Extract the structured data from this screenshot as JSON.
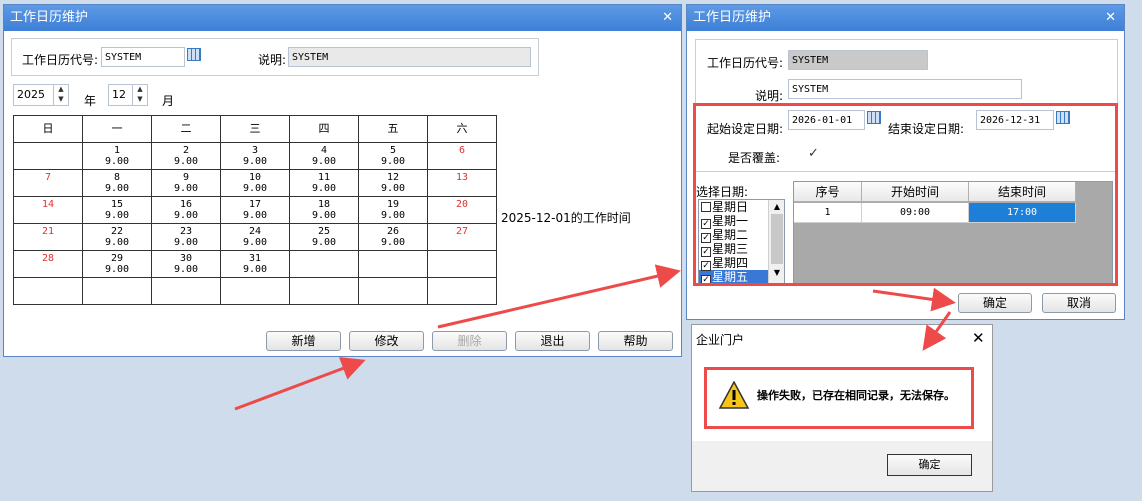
{
  "main_window": {
    "title": "工作日历维护",
    "code_label": "工作日历代号:",
    "code_value": "SYSTEM",
    "desc_label": "说明:",
    "desc_value": "SYSTEM",
    "year_value": "2025",
    "year_label": "年",
    "month_value": "12",
    "month_label": "月",
    "weekday_headers": [
      "日",
      "一",
      "二",
      "三",
      "四",
      "五",
      "六"
    ],
    "worktime_caption": "2025-12-01的工作时间",
    "buttons": {
      "add": "新增",
      "edit": "修改",
      "delete": "删除",
      "exit": "退出",
      "help": "帮助"
    }
  },
  "calendar_weeks": [
    [
      {
        "d": "",
        "h": ""
      },
      {
        "d": "1",
        "h": "9.00"
      },
      {
        "d": "2",
        "h": "9.00"
      },
      {
        "d": "3",
        "h": "9.00"
      },
      {
        "d": "4",
        "h": "9.00"
      },
      {
        "d": "5",
        "h": "9.00"
      },
      {
        "d": "6",
        "h": ""
      }
    ],
    [
      {
        "d": "7",
        "h": ""
      },
      {
        "d": "8",
        "h": "9.00"
      },
      {
        "d": "9",
        "h": "9.00"
      },
      {
        "d": "10",
        "h": "9.00"
      },
      {
        "d": "11",
        "h": "9.00"
      },
      {
        "d": "12",
        "h": "9.00"
      },
      {
        "d": "13",
        "h": ""
      }
    ],
    [
      {
        "d": "14",
        "h": ""
      },
      {
        "d": "15",
        "h": "9.00"
      },
      {
        "d": "16",
        "h": "9.00"
      },
      {
        "d": "17",
        "h": "9.00"
      },
      {
        "d": "18",
        "h": "9.00"
      },
      {
        "d": "19",
        "h": "9.00"
      },
      {
        "d": "20",
        "h": ""
      }
    ],
    [
      {
        "d": "21",
        "h": ""
      },
      {
        "d": "22",
        "h": "9.00"
      },
      {
        "d": "23",
        "h": "9.00"
      },
      {
        "d": "24",
        "h": "9.00"
      },
      {
        "d": "25",
        "h": "9.00"
      },
      {
        "d": "26",
        "h": "9.00"
      },
      {
        "d": "27",
        "h": ""
      }
    ],
    [
      {
        "d": "28",
        "h": ""
      },
      {
        "d": "29",
        "h": "9.00"
      },
      {
        "d": "30",
        "h": "9.00"
      },
      {
        "d": "31",
        "h": "9.00"
      },
      {
        "d": "",
        "h": ""
      },
      {
        "d": "",
        "h": ""
      },
      {
        "d": "",
        "h": ""
      }
    ],
    [
      {
        "d": "",
        "h": ""
      },
      {
        "d": "",
        "h": ""
      },
      {
        "d": "",
        "h": ""
      },
      {
        "d": "",
        "h": ""
      },
      {
        "d": "",
        "h": ""
      },
      {
        "d": "",
        "h": ""
      },
      {
        "d": "",
        "h": ""
      }
    ]
  ],
  "edit_window": {
    "title": "工作日历维护",
    "code_label": "工作日历代号:",
    "code_value": "SYSTEM",
    "desc_label": "说明:",
    "desc_value": "SYSTEM",
    "start_label": "起始设定日期:",
    "start_value": "2026-01-01",
    "end_label": "结束设定日期:",
    "end_value": "2026-12-31",
    "overwrite_label": "是否覆盖:",
    "overwrite_checked": true,
    "select_date_label": "选择日期:",
    "weekdays": [
      {
        "label": "星期日",
        "checked": false
      },
      {
        "label": "星期一",
        "checked": true
      },
      {
        "label": "星期二",
        "checked": true
      },
      {
        "label": "星期三",
        "checked": true
      },
      {
        "label": "星期四",
        "checked": true
      },
      {
        "label": "星期五",
        "checked": true
      }
    ],
    "grid_headers": [
      "序号",
      "开始时间",
      "结束时间"
    ],
    "grid_row": [
      "1",
      "09:00",
      "17:00"
    ],
    "ok_button": "确定",
    "cancel_button": "取消"
  },
  "dialog": {
    "title": "企业门户",
    "message": "操作失败，已存在相同记录，无法保存。",
    "ok_button": "确定"
  },
  "colors": {
    "title_bar": "#3e7fd6",
    "annotation_red": "#ee4a4a",
    "weekend_red": "#e03030",
    "selection_blue": "#1e7fd8"
  }
}
